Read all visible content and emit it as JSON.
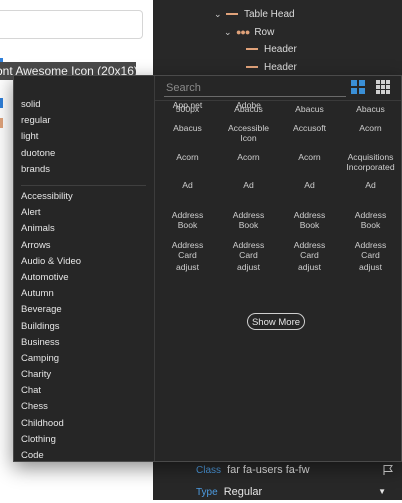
{
  "background": {
    "selected_text": "ont Awesome Icon (20x16)",
    "tree": [
      {
        "label": "Table Head",
        "kind": "bar",
        "chevron": "expanded"
      },
      {
        "label": "Row",
        "kind": "dots",
        "chevron": "expanded"
      },
      {
        "label": "Header",
        "kind": "bar",
        "chevron": "none"
      },
      {
        "label": "Header",
        "kind": "bar",
        "chevron": "none"
      }
    ],
    "class_label": "Class",
    "class_value": "far fa-users fa-fw",
    "type_label": "Type",
    "type_value": "Regular"
  },
  "picker": {
    "styles": [
      "solid",
      "regular",
      "light",
      "duotone",
      "brands"
    ],
    "categories": [
      "Accessibility",
      "Alert",
      "Animals",
      "Arrows",
      "Audio & Video",
      "Automotive",
      "Autumn",
      "Beverage",
      "Buildings",
      "Business",
      "Camping",
      "Charity",
      "Chat",
      "Chess",
      "Childhood",
      "Clothing",
      "Code"
    ],
    "search_placeholder": "Search",
    "icons": [
      {
        "l1": "500px",
        "l2": ""
      },
      {
        "l1": "Abacus",
        "l2": ""
      },
      {
        "l1": "Abacus",
        "l2": ""
      },
      {
        "l1": "Abacus",
        "l2": ""
      },
      {
        "l1": "Abacus",
        "l2": ""
      },
      {
        "l1": "Accessible",
        "l2": "Icon"
      },
      {
        "l1": "Accusoft",
        "l2": ""
      },
      {
        "l1": "Acorn",
        "l2": ""
      },
      {
        "l1": "Acorn",
        "l2": ""
      },
      {
        "l1": "Acorn",
        "l2": ""
      },
      {
        "l1": "Acorn",
        "l2": ""
      },
      {
        "l1": "Acquisitions",
        "l2": "Incorporated"
      },
      {
        "l1": "Ad",
        "l2": ""
      },
      {
        "l1": "Ad",
        "l2": ""
      },
      {
        "l1": "Ad",
        "l2": ""
      },
      {
        "l1": "Ad",
        "l2": ""
      },
      {
        "l1": "Address",
        "l2": "Book"
      },
      {
        "l1": "Address",
        "l2": "Book"
      },
      {
        "l1": "Address",
        "l2": "Book"
      },
      {
        "l1": "Address",
        "l2": "Book"
      },
      {
        "l1": "Address",
        "l2": "Card"
      },
      {
        "l1": "Address",
        "l2": "Card"
      },
      {
        "l1": "Address",
        "l2": "Card"
      },
      {
        "l1": "Address",
        "l2": "Card"
      },
      {
        "l1": "adjust",
        "l2": ""
      },
      {
        "l1": "adjust",
        "l2": ""
      },
      {
        "l1": "adjust",
        "l2": ""
      },
      {
        "l1": "adjust",
        "l2": ""
      },
      {
        "l1": "App.net",
        "l2": ""
      },
      {
        "l1": "Adobe",
        "l2": ""
      }
    ],
    "show_more_label": "Show More",
    "accent_color": "#3a8fd6"
  }
}
